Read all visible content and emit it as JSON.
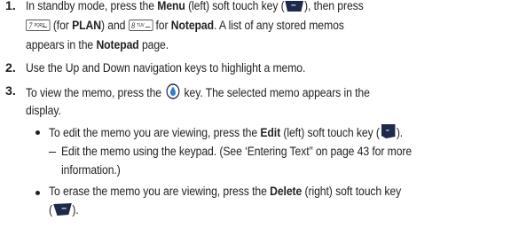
{
  "steps": [
    {
      "number": "1.",
      "line1": {
        "t1": "In standby mode, press the ",
        "b1": "Menu",
        "t2": " (left) soft touch key (",
        "t3": "), then press"
      },
      "line2": {
        "key7_num": "7",
        "key7_letters": "PQRS",
        "t1": " (for ",
        "b1": "PLAN",
        "t2": ") and ",
        "key8_num": "8",
        "key8_letters": "TUV",
        "t3": " for ",
        "b2": "Notepad",
        "t4": ". A list of any stored memos"
      },
      "line3": {
        "t1": "appears in the ",
        "b1": "Notepad",
        "t2": " page."
      }
    },
    {
      "number": "2.",
      "line1": {
        "t1": "Use the Up and Down navigation keys to highlight a memo."
      }
    },
    {
      "number": "3.",
      "line1": {
        "t1": "To view the memo, press the ",
        "t2": " key. The selected memo appears in the"
      },
      "line2": {
        "t1": "display."
      }
    }
  ],
  "bullets": [
    {
      "line1": {
        "t1": "To edit the memo you are viewing, press the ",
        "b1": "Edit",
        "t2": " (left) soft touch key (",
        "t3": ")."
      }
    },
    {
      "line1": {
        "t1": "To erase the memo you are viewing, press the ",
        "b1": "Delete",
        "t2": " (right) soft touch key"
      },
      "line2": {
        "t1": "(",
        "t2": ")."
      }
    }
  ],
  "subitem": {
    "line1": "Edit the memo using the keypad. (See ‘Entering Text” on page 43 for more",
    "line2": "information.)"
  },
  "icons": {
    "menu_softkey": "left-soft-key-icon",
    "ok_key": "ok-key-icon",
    "edit_softkey": "left-soft-key-icon",
    "delete_softkey": "right-soft-key-icon",
    "key_7": "key-7-icon",
    "key_8": "key-8-icon"
  },
  "colors": {
    "text": "#231f20",
    "key_dark": "#1e2a4a",
    "ok_blue": "#2a7fd1"
  }
}
